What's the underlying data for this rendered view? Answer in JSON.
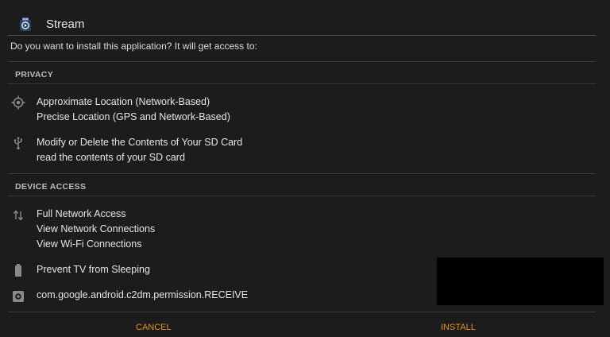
{
  "header": {
    "app_name": "Stream",
    "app_icon": "stream-app-icon"
  },
  "dialog": {
    "question": "Do you want to install this application? It will get access to:"
  },
  "sections": {
    "privacy": {
      "label": "PRIVACY",
      "groups": [
        {
          "icon": "location-crosshair-icon",
          "items": [
            "Approximate Location (Network-Based)",
            "Precise Location (GPS and Network-Based)"
          ]
        },
        {
          "icon": "usb-icon",
          "items": [
            "Modify or Delete the Contents of Your SD Card",
            "read the contents of your SD card"
          ]
        }
      ]
    },
    "device_access": {
      "label": "DEVICE ACCESS",
      "groups": [
        {
          "icon": "network-arrows-icon",
          "items": [
            "Full Network Access",
            "View Network Connections",
            "View Wi-Fi Connections"
          ]
        },
        {
          "icon": "battery-icon",
          "items": [
            "Prevent TV from Sleeping"
          ]
        },
        {
          "icon": "settings-gear-icon",
          "items": [
            "com.google.android.c2dm.permission.RECEIVE"
          ]
        }
      ]
    }
  },
  "actions": {
    "cancel_label": "CANCEL",
    "install_label": "INSTALL"
  },
  "colors": {
    "background": "#1c1c1c",
    "accent": "#e8901f",
    "text": "#e6e6e6",
    "divider": "#3a3a3a",
    "icon": "#8a8a8a"
  }
}
